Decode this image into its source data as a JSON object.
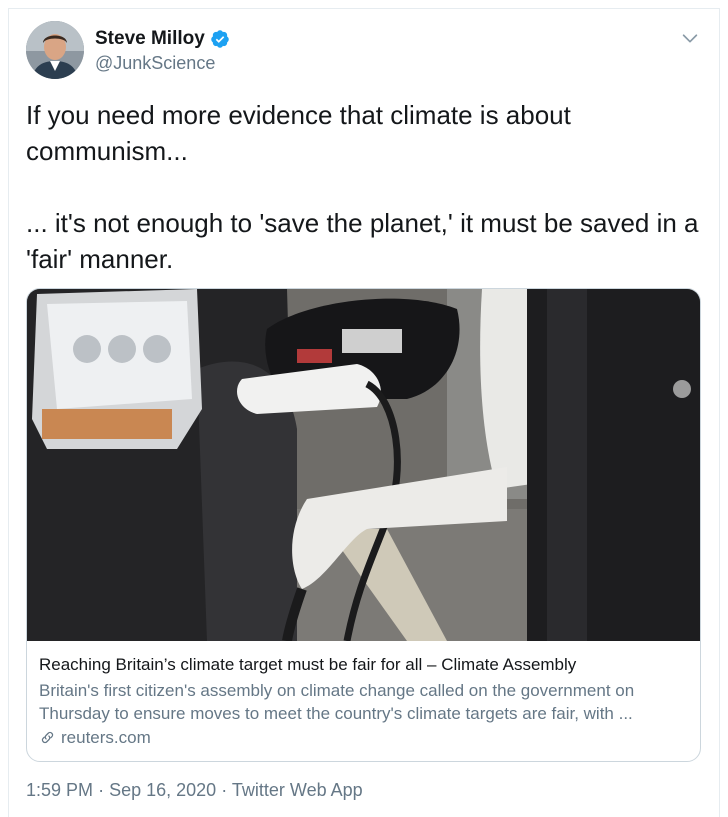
{
  "user": {
    "name": "Steve Milloy",
    "handle": "@JunkScience",
    "verified": true
  },
  "tweet": {
    "paragraphs": [
      "If you need more evidence that climate is about communism...",
      "... it's not enough to 'save the planet,' it must be saved in a 'fair' manner."
    ]
  },
  "card": {
    "title": "Reaching Britain’s climate target must be fair for all – Climate Assembly",
    "description": "Britain's first citizen's assembly on climate change called on the government on Thursday to ensure moves to meet the country's climate targets are fair, with ...",
    "domain": "reuters.com",
    "image_icon": "ev-charging-photo"
  },
  "meta": {
    "time": "1:59 PM",
    "date": "Sep 16, 2020",
    "separator": "·",
    "source": "Twitter Web App"
  },
  "colors": {
    "verified": "#1da1f2",
    "secondary_text": "#657786",
    "border": "#ccd6dd"
  }
}
